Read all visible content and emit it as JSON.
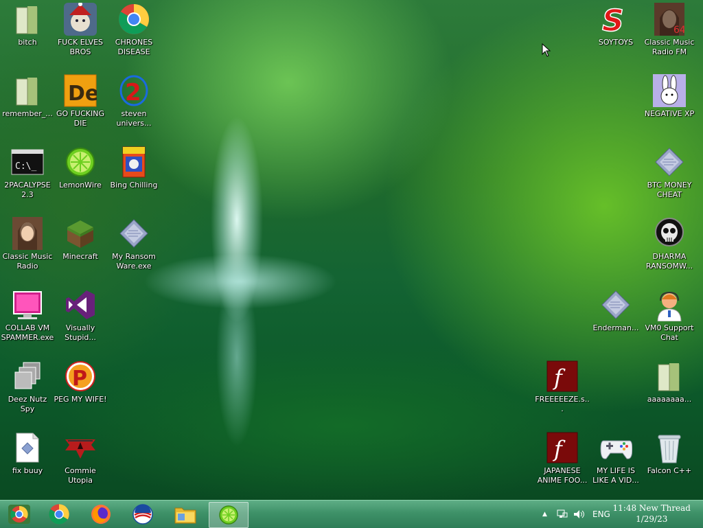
{
  "desktop": {
    "icons": [
      {
        "id": "bitch",
        "label": "bitch",
        "icon": "folder-icon"
      },
      {
        "id": "fuck-elves",
        "label": "FUCK ELVES\nBROS",
        "icon": "elf-face-icon"
      },
      {
        "id": "chrones",
        "label": "CHRONES\nDISEASE",
        "icon": "chrome-icon"
      },
      {
        "id": "soytoys",
        "label": "SOYTOYS",
        "icon": "red-s-icon"
      },
      {
        "id": "classic-music-fm",
        "label": "Classic Music\nRadio FM",
        "icon": "portrait-icon"
      },
      {
        "id": "remember",
        "label": "remember_...",
        "icon": "folder-icon"
      },
      {
        "id": "go-die",
        "label": "GO FUCKING\nDIE",
        "icon": "de-icon"
      },
      {
        "id": "steven",
        "label": "steven\nunivers...",
        "icon": "number-2-icon"
      },
      {
        "id": "negative-xp",
        "label": "NEGATIVE XP",
        "icon": "bunny-icon"
      },
      {
        "id": "2pacalypse",
        "label": "2PACALYPSE\n2.3",
        "icon": "cmd-icon"
      },
      {
        "id": "lemonwire",
        "label": "LemonWire",
        "icon": "lime-icon"
      },
      {
        "id": "bing-chilling",
        "label": "Bing Chilling",
        "icon": "cereal-box-icon"
      },
      {
        "id": "btc-money",
        "label": "BTC MONEY\nCHEAT",
        "icon": "script-icon"
      },
      {
        "id": "classic-music",
        "label": "Classic Music\nRadio",
        "icon": "portrait-icon"
      },
      {
        "id": "minecraft",
        "label": "Minecraft",
        "icon": "grass-block-icon"
      },
      {
        "id": "ransomware",
        "label": "My Ransom\nWare.exe",
        "icon": "script-icon"
      },
      {
        "id": "dharma",
        "label": "DHARMA\nRANSOMW...",
        "icon": "skull-icon"
      },
      {
        "id": "collab-vm",
        "label": "COLLAB VM\nSPAMMER.exe",
        "icon": "monitor-icon"
      },
      {
        "id": "visually-stupid",
        "label": "Visually\nStupid...",
        "icon": "visual-studio-icon"
      },
      {
        "id": "enderman",
        "label": "Enderman...",
        "icon": "script-icon"
      },
      {
        "id": "vm0-support",
        "label": "VM0 Support\nChat",
        "icon": "support-person-icon"
      },
      {
        "id": "deez-nutz",
        "label": "Deez Nutz\nSpy",
        "icon": "windows-stack-icon"
      },
      {
        "id": "peg-my-wife",
        "label": "PEG MY WIFE!",
        "icon": "p-logo-icon"
      },
      {
        "id": "freeeeeze",
        "label": "FREEEEEZE.s...",
        "icon": "flash-icon"
      },
      {
        "id": "aaaaaaa",
        "label": "aaaaaaaa...",
        "icon": "folder-icon"
      },
      {
        "id": "fix-buuy",
        "label": "fix buuy",
        "icon": "document-icon"
      },
      {
        "id": "commie-utopia",
        "label": "Commie\nUtopia",
        "icon": "red-emblem-icon"
      },
      {
        "id": "japanese-anime",
        "label": "JAPANESE\nANIME FOO...",
        "icon": "flash-icon"
      },
      {
        "id": "my-life",
        "label": "MY LIFE IS\nLIKE A VID...",
        "icon": "gamepad-icon"
      },
      {
        "id": "falcon",
        "label": "Falcon C++",
        "icon": "recycle-bin-icon"
      }
    ]
  },
  "taskbar": {
    "pinned": [
      {
        "icon": "chrome-old-icon"
      },
      {
        "icon": "chrome-icon"
      },
      {
        "icon": "firefox-icon"
      },
      {
        "icon": "obama-logo-icon"
      },
      {
        "icon": "file-explorer-icon"
      },
      {
        "icon": "lime-icon",
        "active": true
      }
    ],
    "tray": {
      "language": "ENG",
      "time": "11:48 New Thread",
      "date": "1/29/23"
    }
  },
  "colors": {
    "taskbar": "#3e9168",
    "accent": "#e02020"
  }
}
